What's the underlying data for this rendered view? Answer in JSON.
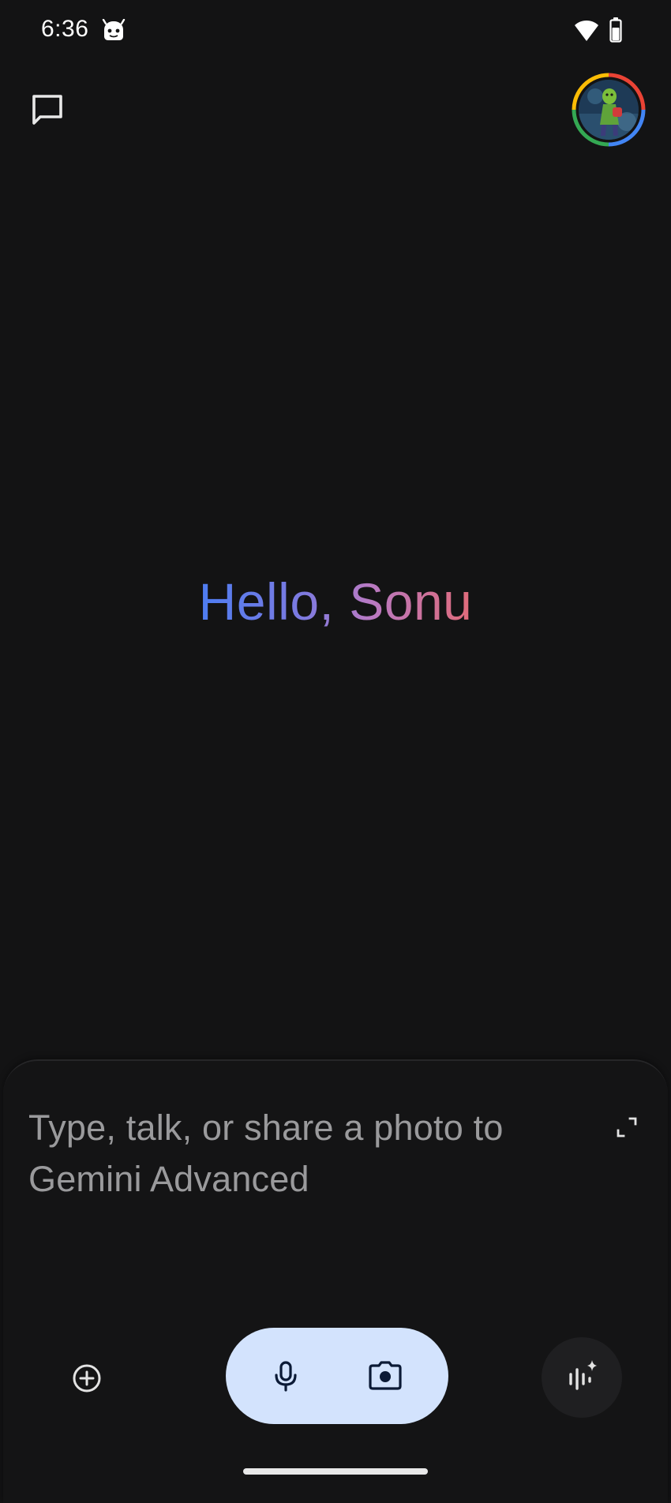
{
  "status_bar": {
    "time": "6:36",
    "app_icon": "android-robot-icon",
    "wifi_icon": "wifi-icon",
    "battery_icon": "battery-icon"
  },
  "header": {
    "new_chat_icon": "chat-bubble-icon",
    "avatar": "profile-avatar"
  },
  "greeting": {
    "text": "Hello, Sonu",
    "gradient_colors": [
      "#4d7df2",
      "#7d7ae0",
      "#b77ac4",
      "#e06b7a"
    ]
  },
  "composer": {
    "placeholder": "Type, talk, or share a photo to Gemini Advanced",
    "expand_icon": "expand-icon",
    "add_icon": "add-circle-icon",
    "mic_icon": "microphone-icon",
    "camera_icon": "camera-icon",
    "live_icon": "gemini-live-icon",
    "pill_color": "#d3e3fd"
  },
  "theme": {
    "background": "#131314",
    "text_primary": "#e3e3e3",
    "placeholder_color": "#9a9a9c"
  }
}
